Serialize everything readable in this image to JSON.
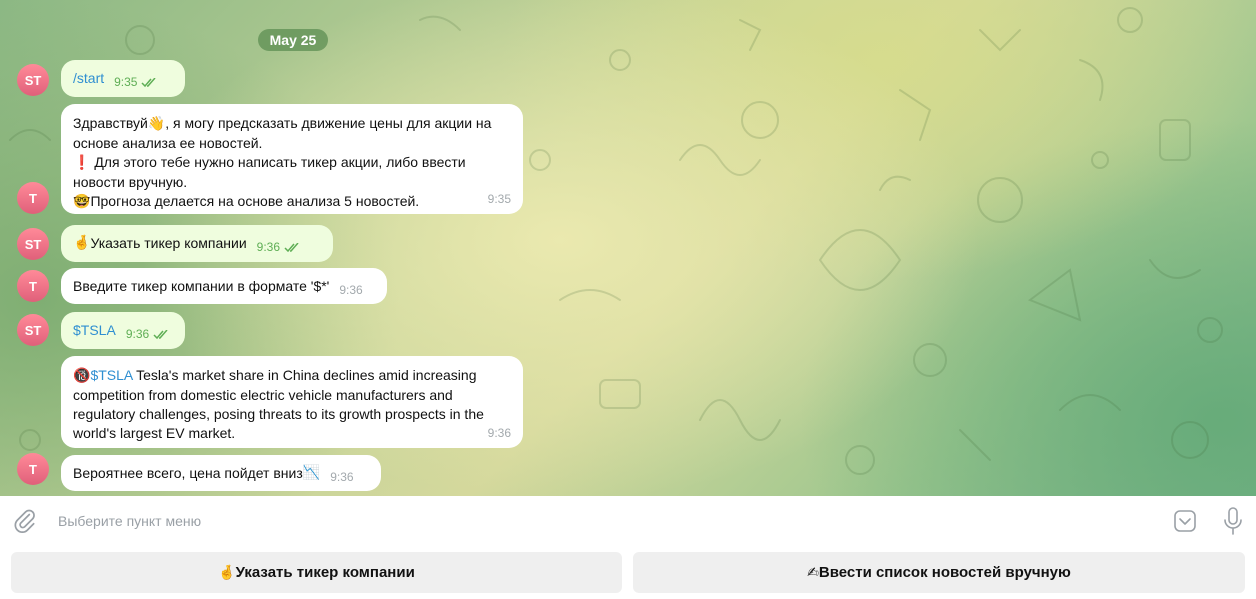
{
  "chat": {
    "date": "May 25",
    "messages": [
      {
        "avatar": "ST",
        "text": "/start",
        "time": "9:35"
      },
      {
        "avatar": "T",
        "lines": [
          {
            "emoji": "",
            "text": "Здравствуй",
            "emoji_after": "👋",
            "rest": ", я могу предсказать движение цены для акции на"
          },
          {
            "text": "основе анализа ее новостей."
          },
          {
            "emoji": "❗",
            "text": " Для этого тебе нужно написать тикер акции, либо ввести"
          },
          {
            "text": "новости вручную."
          },
          {
            "emoji": "🤓",
            "text": "Прогноза делается на основе анализа 5 новостей."
          }
        ],
        "time": "9:35"
      },
      {
        "avatar": "ST",
        "emoji": "🤞",
        "text": "Указать тикер компании",
        "time": "9:36"
      },
      {
        "avatar": "T",
        "text": "Введите тикер компании в формате '$*'",
        "time": "9:36"
      },
      {
        "avatar": "ST",
        "text": "$TSLA",
        "time": "9:36"
      },
      {
        "avatar": "T",
        "emoji": "🔞",
        "ticker": "$TSLA",
        "lines": [
          " Tesla's market share in China declines amid increasing",
          "competition from domestic electric vehicle manufacturers and",
          "regulatory challenges, posing threats to its growth prospects in the",
          "world's largest EV market."
        ],
        "time": "9:36"
      },
      {
        "avatar": "T",
        "text": "Вероятнее всего, цена пойдет вниз",
        "emoji": "📉",
        "time": "9:36"
      }
    ]
  },
  "composer": {
    "placeholder": "Выберите пункт меню"
  },
  "keyboard": {
    "buttons": [
      {
        "emoji": "🤞",
        "label": "Указать тикер компании"
      },
      {
        "emoji": "✍",
        "label": "Ввести список новостей вручную"
      }
    ]
  },
  "icons": {
    "attach": "paperclip-icon",
    "keyboard": "keyboard-toggle-icon",
    "mic": "microphone-icon",
    "read": "double-check-icon"
  },
  "colors": {
    "accent_link": "#2f8fd1",
    "read_check": "#5fae55",
    "avatar": "#e56b82",
    "outgoing_bubble": "#effdde"
  }
}
